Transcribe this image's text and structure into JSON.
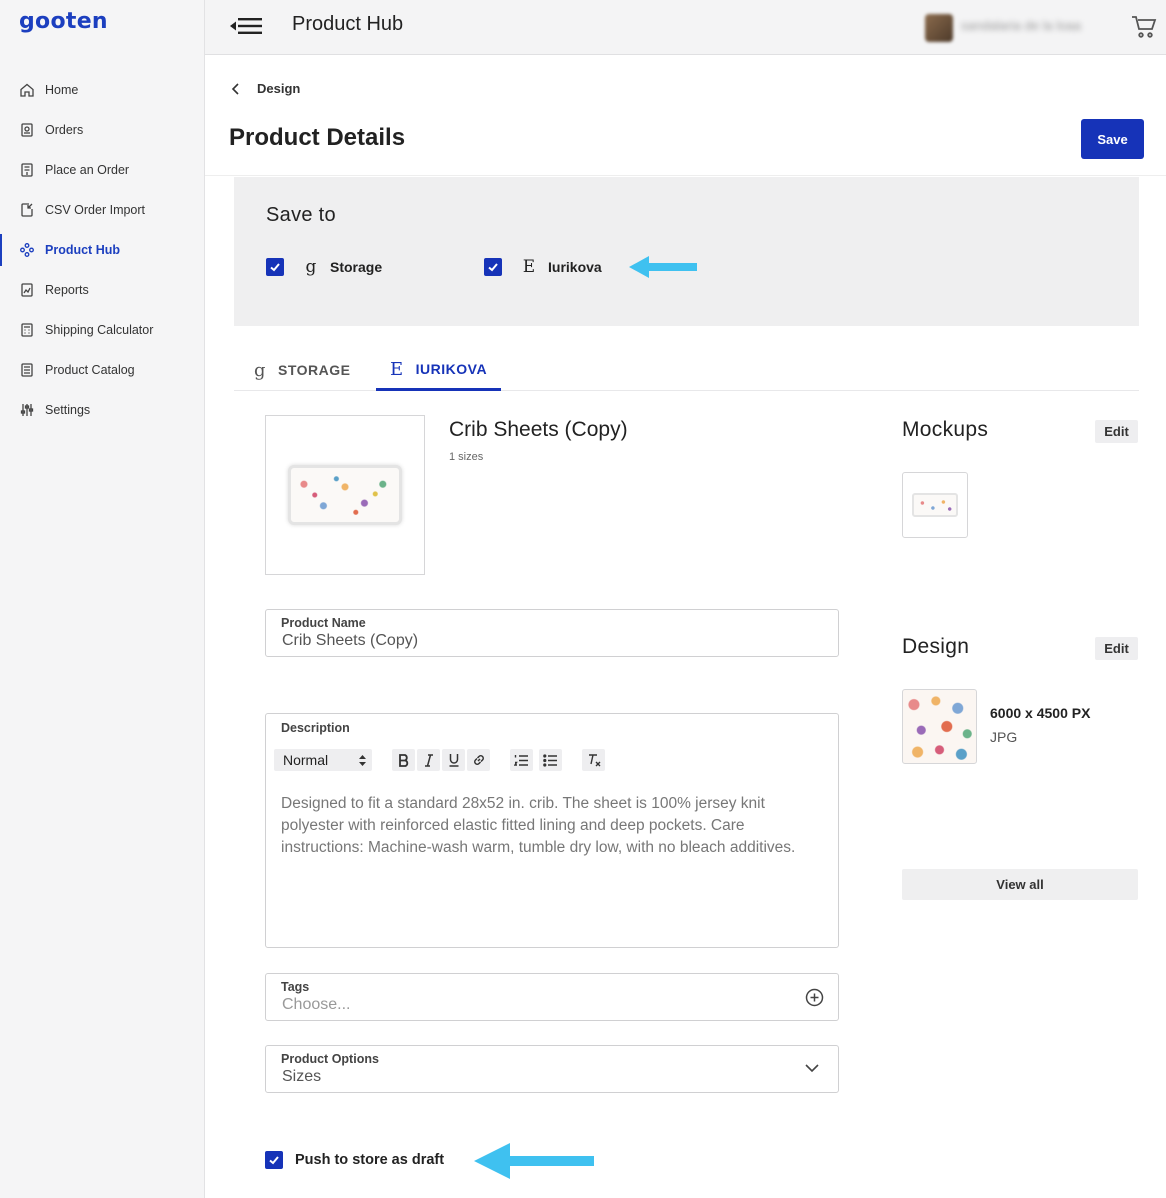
{
  "sidebar": {
    "logo": "gooten",
    "items": [
      {
        "label": "Home",
        "icon": "home-icon"
      },
      {
        "label": "Orders",
        "icon": "orders-icon"
      },
      {
        "label": "Place an Order",
        "icon": "place-order-icon"
      },
      {
        "label": "CSV Order Import",
        "icon": "csv-import-icon"
      },
      {
        "label": "Product Hub",
        "icon": "product-hub-icon",
        "active": true
      },
      {
        "label": "Reports",
        "icon": "reports-icon"
      },
      {
        "label": "Shipping Calculator",
        "icon": "calculator-icon"
      },
      {
        "label": "Product Catalog",
        "icon": "catalog-icon"
      },
      {
        "label": "Settings",
        "icon": "settings-icon"
      }
    ]
  },
  "header": {
    "title": "Product Hub",
    "user_name": "sandalaria de la loaa"
  },
  "breadcrumb": "Design",
  "page_title": "Product Details",
  "save_label": "Save",
  "save_to": {
    "title": "Save to",
    "options": [
      {
        "brand": "g",
        "label": "Storage",
        "checked": true
      },
      {
        "brand": "E",
        "label": "Iurikova",
        "checked": true
      }
    ]
  },
  "tabs": [
    {
      "brand": "g",
      "label": "STORAGE",
      "active": false
    },
    {
      "brand": "E",
      "label": "IURIKOVA",
      "active": true
    }
  ],
  "product": {
    "title": "Crib Sheets (Copy)",
    "sizes": "1 sizes"
  },
  "fields": {
    "name_label": "Product Name",
    "name_value": "Crib Sheets  (Copy)",
    "description_label": "Description",
    "text_style": "Normal",
    "description_text": "Designed to fit a standard 28x52 in. crib. The sheet is 100% jersey knit polyester with reinforced elastic fitted lining and deep pockets. Care instructions: Machine-wash warm, tumble dry low, with no bleach additives.",
    "tags_label": "Tags",
    "tags_placeholder": "Choose...",
    "options_label": "Product Options",
    "options_value": "Sizes"
  },
  "mockups": {
    "title": "Mockups",
    "edit_label": "Edit"
  },
  "design": {
    "title": "Design",
    "edit_label": "Edit",
    "dimensions": "6000 x 4500 PX",
    "format": "JPG",
    "view_all_label": "View all"
  },
  "push_draft": {
    "label": "Push to store as draft",
    "checked": true
  },
  "colors": {
    "accent": "#1633b8",
    "arrow": "#3fc1f0",
    "logo": "#1c3fbf"
  }
}
